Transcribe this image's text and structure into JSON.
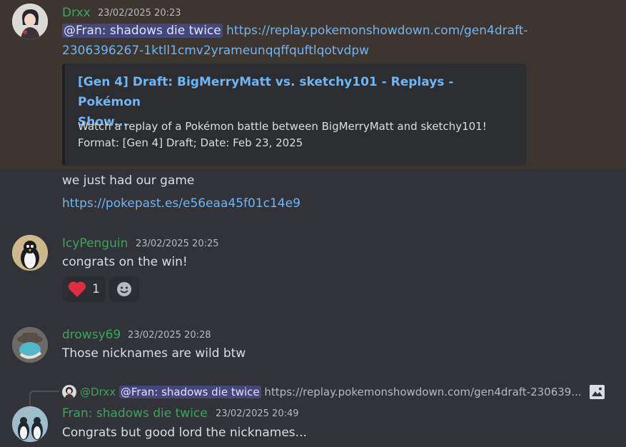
{
  "messages": [
    {
      "username": "Drxx",
      "timestamp": "23/02/2025 20:23",
      "mention": "@Fran: shadows die twice",
      "link_line1": "https://replay.pokemonshowdown.com/gen4draft-",
      "link_line2": "2306396267-1ktll1cmv2yrameunqqffquftlqotvdpw",
      "embed": {
        "title_line1": "[Gen 4] Draft: BigMerryMatt vs. sketchy101 - Replays - Pokémon",
        "title_line2": "Show...",
        "desc_line1": "Watch a replay of a Pokémon battle between BigMerryMatt and sketchy101!",
        "desc_line2": "Format: [Gen 4] Draft; Date: Feb 23, 2025"
      },
      "followup_text": "we just had our game",
      "followup_link": "https://pokepast.es/e56eaa45f01c14e9"
    },
    {
      "username": "IcyPenguin",
      "timestamp": "23/02/2025 20:25",
      "text": "congrats on the win!",
      "reaction_count": "1"
    },
    {
      "username": "drowsy69",
      "timestamp": "23/02/2025 20:28",
      "text": "Those nicknames are wild btw"
    },
    {
      "reply": {
        "author": "@Drxx",
        "mention": "@Fran: shadows die twice",
        "preview": "https://replay.pokemonshowdown.com/gen4draft-230639..."
      },
      "username": "Fran: shadows die twice",
      "timestamp": "23/02/2025 20:49",
      "text": "Congrats but good lord the nicknames..."
    }
  ],
  "colors": {
    "username": "#3ba55d",
    "link": "#6eb6f5",
    "background": "#313338",
    "highlight": "#3c3530"
  }
}
